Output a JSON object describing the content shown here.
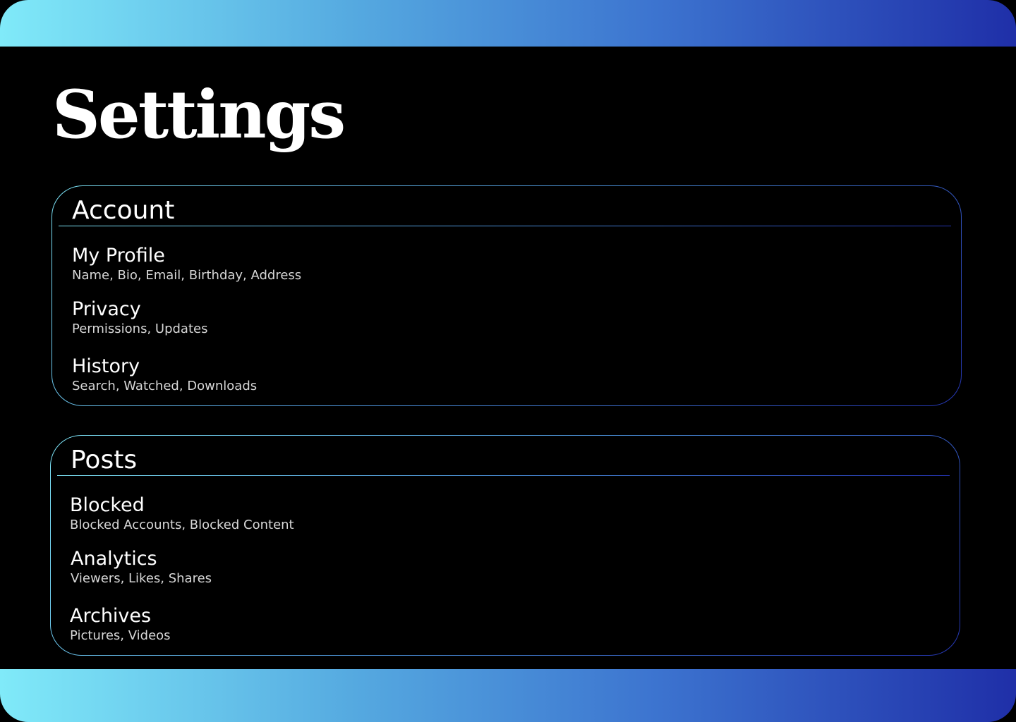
{
  "page": {
    "title": "Settings"
  },
  "colors": {
    "background": "#000000",
    "gradient_start": "#80EAF9",
    "gradient_end": "#1F2FA8",
    "text_primary": "#ffffff",
    "text_secondary": "#d7d7d7"
  },
  "sections": {
    "account": {
      "heading": "Account",
      "items": [
        {
          "title": "My Profile",
          "subtitle": "Name, Bio, Email, Birthday, Address"
        },
        {
          "title": "Privacy",
          "subtitle": "Permissions, Updates"
        },
        {
          "title": "History",
          "subtitle": "Search, Watched, Downloads"
        }
      ]
    },
    "posts": {
      "heading": "Posts",
      "items": [
        {
          "title": "Blocked",
          "subtitle": "Blocked Accounts, Blocked Content"
        },
        {
          "title": "Analytics",
          "subtitle": "Viewers, Likes, Shares"
        },
        {
          "title": "Archives",
          "subtitle": "Pictures, Videos"
        }
      ]
    }
  }
}
